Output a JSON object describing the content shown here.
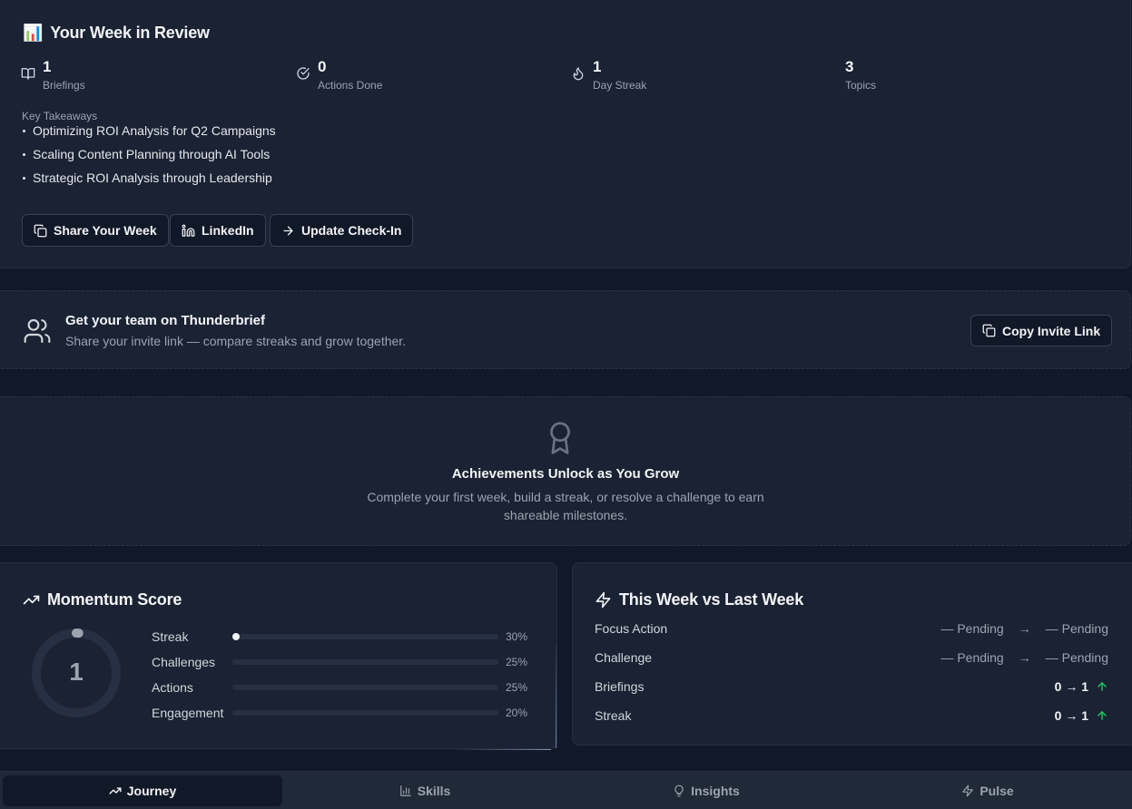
{
  "week": {
    "emoji": "📊",
    "title": "Your Week in Review",
    "stats": [
      {
        "icon": "book-open-icon",
        "value": "1",
        "label": "Briefings"
      },
      {
        "icon": "check-circle-icon",
        "value": "0",
        "label": "Actions Done"
      },
      {
        "icon": "flame-icon",
        "value": "1",
        "label": "Day Streak"
      },
      {
        "icon": "",
        "value": "3",
        "label": "Topics"
      }
    ],
    "takeaways_heading": "Key Takeaways",
    "takeaways": [
      "Optimizing ROI Analysis for Q2 Campaigns",
      "Scaling Content Planning through AI Tools",
      "Strategic ROI Analysis through Leadership"
    ],
    "buttons": {
      "share": "Share Your Week",
      "linkedin": "LinkedIn",
      "checkin": "Update Check-In"
    }
  },
  "invite": {
    "title": "Get your team on Thunderbrief",
    "subtitle": "Share your invite link — compare streaks and grow together.",
    "button": "Copy Invite Link"
  },
  "achievements": {
    "title": "Achievements Unlock as You Grow",
    "subtitle": "Complete your first week, build a streak, or resolve a challenge to earn shareable milestones."
  },
  "momentum": {
    "title": "Momentum Score",
    "score": "1",
    "score_fraction": 0.01,
    "rows": [
      {
        "label": "Streak",
        "pct": "30%",
        "progress": 0.0
      },
      {
        "label": "Challenges",
        "pct": "25%",
        "progress": 0.0
      },
      {
        "label": "Actions",
        "pct": "25%",
        "progress": 0.0
      },
      {
        "label": "Engagement",
        "pct": "20%",
        "progress": 0.0
      }
    ]
  },
  "compare": {
    "title": "This Week vs Last Week",
    "rows": [
      {
        "label": "Focus Action",
        "last": "— Pending",
        "arrow": "→",
        "this": "— Pending"
      },
      {
        "label": "Challenge",
        "last": "— Pending",
        "arrow": "→",
        "this": "— Pending"
      },
      {
        "label": "Briefings",
        "value": "0 → 1",
        "trend": "up"
      },
      {
        "label": "Streak",
        "value": "0 → 1",
        "trend": "up"
      }
    ]
  },
  "tabs": [
    {
      "label": "Journey",
      "icon": "trending-up-icon",
      "active": true
    },
    {
      "label": "Skills",
      "icon": "bar-chart-icon",
      "active": false
    },
    {
      "label": "Insights",
      "icon": "lightbulb-icon",
      "active": false
    },
    {
      "label": "Pulse",
      "icon": "zap-icon",
      "active": false
    }
  ],
  "colors": {
    "background": "#111827",
    "card": "#1a2233",
    "accent_up": "#22c55e"
  }
}
